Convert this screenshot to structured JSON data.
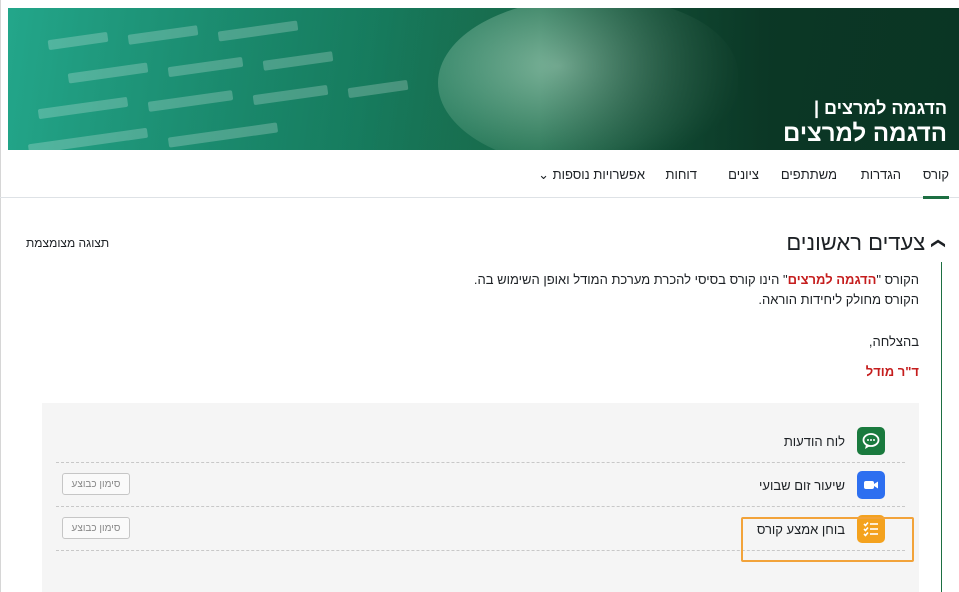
{
  "header": {
    "subtitle": "הדגמה למרצים |",
    "title": "הדגמה למרצים"
  },
  "nav": {
    "items": [
      "קורס",
      "הגדרות",
      "משתתפים",
      "ציונים",
      "דוחות",
      "אפשרויות נוספות ⌄"
    ],
    "active": "קורס"
  },
  "section": {
    "title": "צעדים ראשונים",
    "collapse_link": "תצוגה מצומצמת",
    "summary": {
      "line1_pre": "הקורס \"",
      "line1_highlight": "הדגמה למרצים",
      "line1_post": "\" הינו קורס בסיסי להכרת מערכת המודל ואופן השימוש בה.",
      "line2": "הקורס מחולק ליחידות הוראה.",
      "line3": "בהצלחה,",
      "signature": "ד\"ר מודל"
    }
  },
  "activities": [
    {
      "name": "לוח הודעות",
      "icon": "chat-bubble-icon",
      "color": "#1a7a3e",
      "button": ""
    },
    {
      "name": "שיעור זום שבועי",
      "icon": "zoom-camera-icon",
      "color": "#2d6ff0",
      "button": "סימון כבוצע"
    },
    {
      "name": "בוחן אמצע קורס",
      "icon": "quiz-checklist-icon",
      "color": "#f4a21e",
      "button": "סימון כבוצע"
    }
  ]
}
